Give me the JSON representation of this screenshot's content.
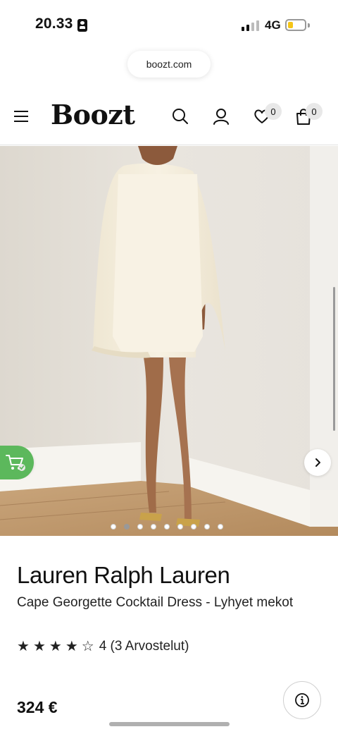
{
  "status_bar": {
    "time": "20.33",
    "network": "4G",
    "battery_level": 0.3
  },
  "browser": {
    "url": "boozt.com"
  },
  "header": {
    "logo": "Boozt",
    "icons": [
      "menu-icon",
      "search-icon",
      "account-icon",
      "heart-icon",
      "bag-icon"
    ],
    "wishlist_count": "0",
    "cart_count": "0"
  },
  "gallery": {
    "image_count": 9,
    "active_index": 1,
    "icons": [
      "chevron-left-icon",
      "chevron-right-icon",
      "cart-check-icon"
    ]
  },
  "product": {
    "brand": "Lauren Ralph Lauren",
    "name": "Cape Georgette Cocktail Dress - Lyhyet mekot",
    "rating": 4,
    "rating_max": 5,
    "rating_text": "4 (3 Arvostelut)",
    "price": "324 €"
  },
  "colors": {
    "accent_green": "#5cb85c",
    "text": "#111111",
    "battery": "#f5c518"
  }
}
